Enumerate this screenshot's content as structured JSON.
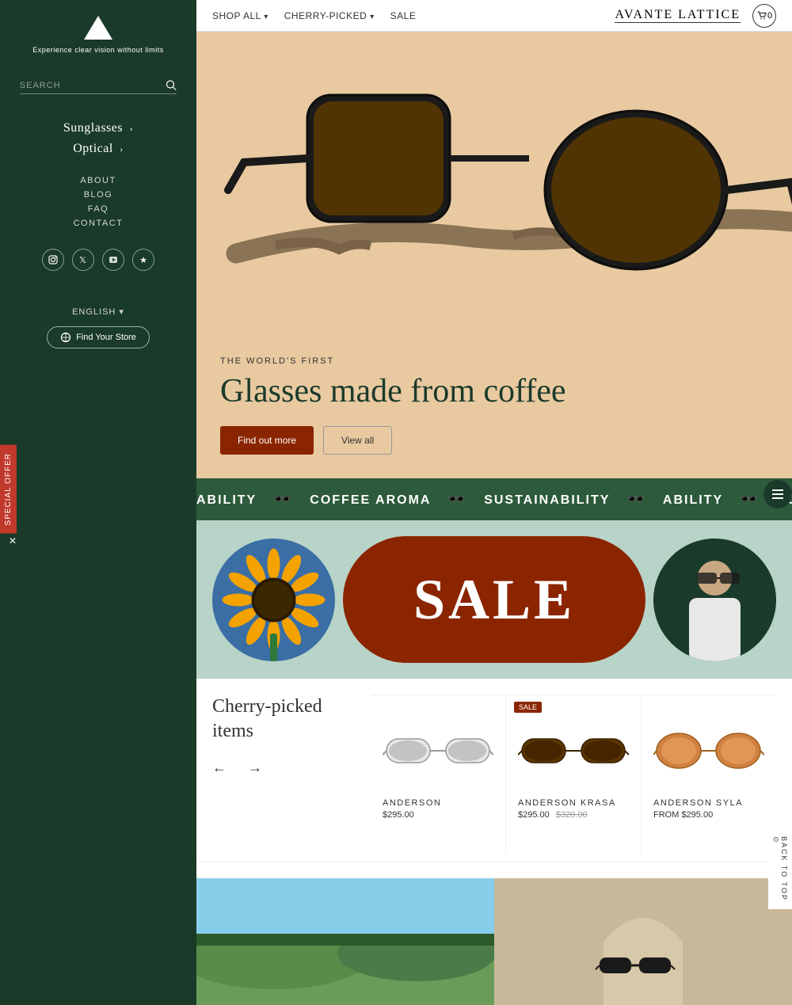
{
  "brand": {
    "name": "AVANTE LATTICE",
    "tagline": "Experience clear vision without limits"
  },
  "sidebar": {
    "search_placeholder": "SEARCH",
    "nav_main": [
      {
        "label": "Sunglasses",
        "has_chevron": true
      },
      {
        "label": "Optical",
        "has_chevron": true
      }
    ],
    "nav_sub": [
      {
        "label": "ABOUT"
      },
      {
        "label": "BLOG"
      },
      {
        "label": "FAQ"
      },
      {
        "label": "CONTACT"
      }
    ],
    "social": [
      "instagram",
      "twitter",
      "youtube",
      "star"
    ],
    "language": "ENGLISH",
    "find_store": "Find Your Store"
  },
  "topnav": {
    "items": [
      {
        "label": "SHOP ALL",
        "has_arrow": true
      },
      {
        "label": "CHERRY-PICKED",
        "has_arrow": true
      },
      {
        "label": "SALE"
      }
    ],
    "cart": "0"
  },
  "hero": {
    "subtitle": "THE WORLD'S FIRST",
    "title": "Glasses made from coffee",
    "btn_find": "Find out more",
    "btn_view": "View all"
  },
  "scrollbanner": {
    "items": [
      "ABILITY",
      "COFFEE AROMA",
      "SU"
    ]
  },
  "special_offer": {
    "label": "SPECIAL OFFER"
  },
  "cherry": {
    "title": "Cherry-picked items",
    "products": [
      {
        "name": "ANDERSON",
        "price": "$295.00",
        "old_price": null,
        "sale": false
      },
      {
        "name": "ANDERSON KRASA",
        "price": "$295.00",
        "old_price": "$320.00",
        "sale": true
      },
      {
        "name": "ANDERSON SYLA",
        "price": "FROM $295.00",
        "old_price": null,
        "sale": false
      }
    ]
  },
  "back_to_top": "BACK TO TOP"
}
